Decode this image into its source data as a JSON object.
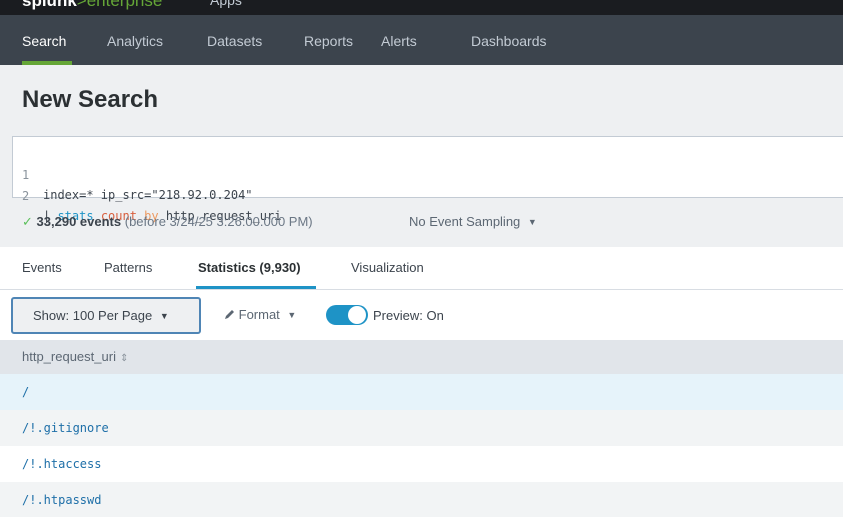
{
  "topbar": {
    "brand_main": "splunk",
    "brand_accent": ">enterprise",
    "apps_label": "Apps"
  },
  "nav": {
    "items": [
      "Search",
      "Analytics",
      "Datasets",
      "Reports",
      "Alerts",
      "Dashboards"
    ],
    "active": "Search"
  },
  "page": {
    "title": "New Search"
  },
  "query": {
    "lines": [
      {
        "number": "1",
        "text": "index=* ip_src=\"218.92.0.204\""
      },
      {
        "number": "2",
        "pipe": "| ",
        "command": "stats",
        "function": "count",
        "keyword": "by",
        "field": "http_request_uri"
      }
    ]
  },
  "status": {
    "check_icon": "✓",
    "events": "33,290 events",
    "detail": "(before 3/24/25 3:26:00.000 PM)",
    "sampling": "No Event Sampling"
  },
  "tabs": [
    "Events",
    "Patterns",
    "Statistics (9,930)",
    "Visualization"
  ],
  "active_tab": "Statistics (9,930)",
  "toolbar": {
    "show_label": "Show: 100 Per Page",
    "format_label": "Format",
    "preview_label": "Preview: On",
    "preview_on": true
  },
  "table": {
    "column": "http_request_uri",
    "rows": [
      "/",
      "/!.gitignore",
      "/!.htaccess",
      "/!.htpasswd"
    ]
  },
  "colors": {
    "accent_green": "#65a637",
    "accent_blue": "#1e93c6",
    "nav_bg": "#3c444d"
  }
}
